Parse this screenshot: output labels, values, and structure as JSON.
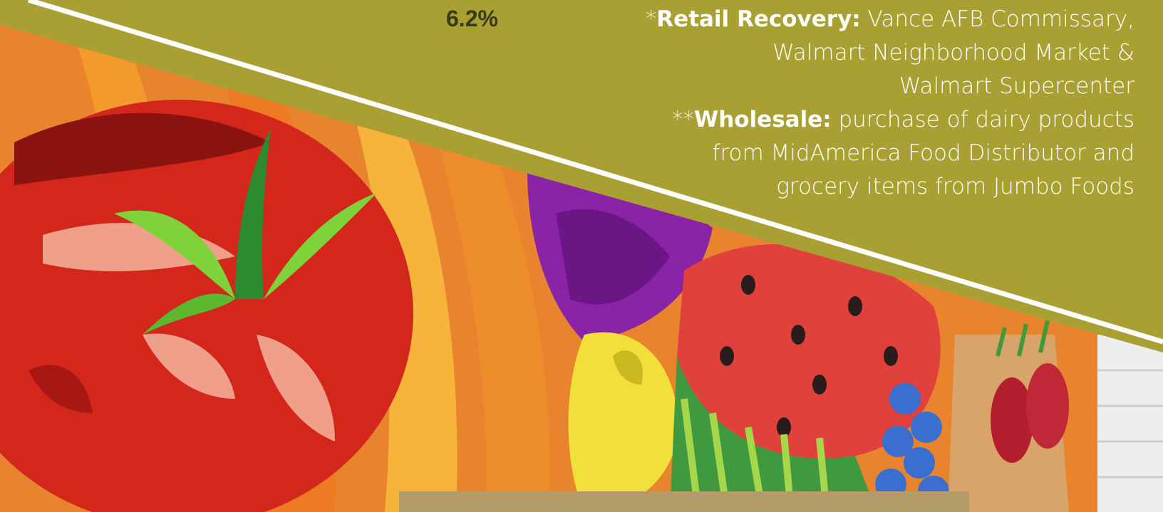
{
  "stat": {
    "value": "6.2%"
  },
  "notes": {
    "retail": {
      "prefix": "*",
      "label": "Retail Recovery:",
      "line1": " Vance AFB Commissary,",
      "line2": "Walmart Neighborhood Market &",
      "line3": "Walmart Supercenter"
    },
    "wholesale": {
      "prefix": "**",
      "label": "Wholesale:",
      "line1": " purchase of dairy products",
      "line2": "from MidAmerica Food Distributor and",
      "line3": "grocery items from Jumbo Foods"
    }
  },
  "colors": {
    "band": "#a9a033",
    "stat": "#3a3a12",
    "divider": "#ffffff"
  },
  "image": {
    "subject": "colorful produce mural"
  }
}
